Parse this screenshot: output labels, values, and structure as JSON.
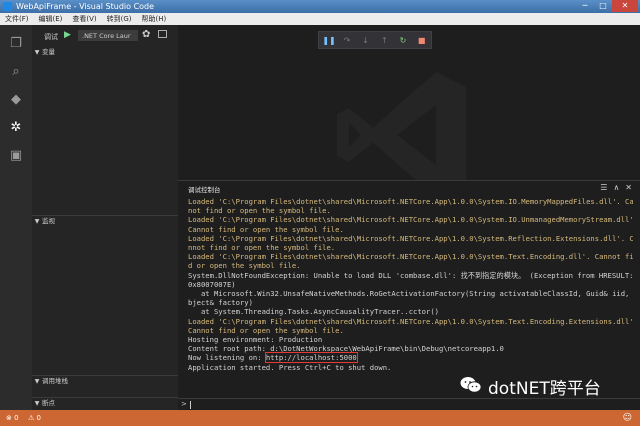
{
  "window": {
    "title": "WebApiFrame - Visual Studio Code",
    "minimize": "─",
    "maximize": "□",
    "close": "✕"
  },
  "menu": [
    "文件(F)",
    "编辑(E)",
    "查看(V)",
    "转到(G)",
    "帮助(H)"
  ],
  "activity_bar": [
    {
      "name": "explorer-icon",
      "glyph": "❐"
    },
    {
      "name": "search-icon",
      "glyph": "⌕"
    },
    {
      "name": "git-icon",
      "glyph": "◆"
    },
    {
      "name": "debug-icon",
      "glyph": "✲"
    },
    {
      "name": "extensions-icon",
      "glyph": "▣"
    }
  ],
  "sidebar": {
    "debug_label": "调试",
    "play_glyph": "▶",
    "config_selected": ".NET Core Laur",
    "gear_glyph": "✿",
    "sections": {
      "variables": "变量",
      "watch": "监视",
      "call_stack": "调用堆栈",
      "breakpoints": "断点"
    }
  },
  "float_toolbar": {
    "pause": "❚❚",
    "step_over": "↷",
    "step_into": "↓",
    "step_out": "↑",
    "restart": "↻",
    "stop": "■"
  },
  "panel": {
    "title": "调试控制台",
    "icons": {
      "clear": "☰",
      "collapse": "∧",
      "close": "✕"
    },
    "lines": [
      {
        "t": "Loaded 'C:\\Program Files\\dotnet\\shared\\Microsoft.NETCore.App\\1.0.0\\System.IO.MemoryMappedFiles.dll'. Can",
        "c": "warn"
      },
      {
        "t": "not find or open the symbol file.",
        "c": "warn"
      },
      {
        "t": "Loaded 'C:\\Program Files\\dotnet\\shared\\Microsoft.NETCore.App\\1.0.0\\System.IO.UnmanagedMemoryStream.dll'.",
        "c": "warn"
      },
      {
        "t": "Cannot find or open the symbol file.",
        "c": "warn"
      },
      {
        "t": "Loaded 'C:\\Program Files\\dotnet\\shared\\Microsoft.NETCore.App\\1.0.0\\System.Reflection.Extensions.dll'. Ca",
        "c": "warn"
      },
      {
        "t": "nnot find or open the symbol file.",
        "c": "warn"
      },
      {
        "t": "Loaded 'C:\\Program Files\\dotnet\\shared\\Microsoft.NETCore.App\\1.0.0\\System.Text.Encoding.dll'. Cannot fin",
        "c": "warn"
      },
      {
        "t": "d or open the symbol file.",
        "c": "warn"
      },
      {
        "t": "System.DllNotFoundException: Unable to load DLL 'combase.dll': 找不到指定的模块。 (Exception from HRESULT:",
        "c": "info"
      },
      {
        "t": "0x8007007E)",
        "c": "info"
      },
      {
        "t": "   at Microsoft.Win32.UnsafeNativeMethods.RoGetActivationFactory(String activatableClassId, Guid& iid, O",
        "c": "info"
      },
      {
        "t": "bject& factory)",
        "c": "info"
      },
      {
        "t": "   at System.Threading.Tasks.AsyncCausalityTracer..cctor()",
        "c": "info"
      },
      {
        "t": "Loaded 'C:\\Program Files\\dotnet\\shared\\Microsoft.NETCore.App\\1.0.0\\System.Text.Encoding.Extensions.dll'.",
        "c": "warn"
      },
      {
        "t": "Cannot find or open the symbol file.",
        "c": "warn"
      },
      {
        "t": "Hosting environment: Production",
        "c": "info"
      },
      {
        "t": "Content root path: d:\\DotNetWorkspace\\WebApiFrame\\bin\\Debug\\netcoreapp1.0",
        "c": "info"
      }
    ],
    "listening_prefix": "Now listening on: ",
    "listening_url": "http://localhost:5000",
    "last_line": "Application started. Press Ctrl+C to shut down.",
    "prompt": ">"
  },
  "status": {
    "errors": "⊗ 0",
    "warnings": "⚠ 0",
    "smile": "☺"
  },
  "brand": {
    "text": "dotNET跨平台"
  },
  "colors": {
    "status_bg": "#cc6633",
    "warn_text": "#d7ba7d",
    "highlight_border": "#e53935"
  }
}
